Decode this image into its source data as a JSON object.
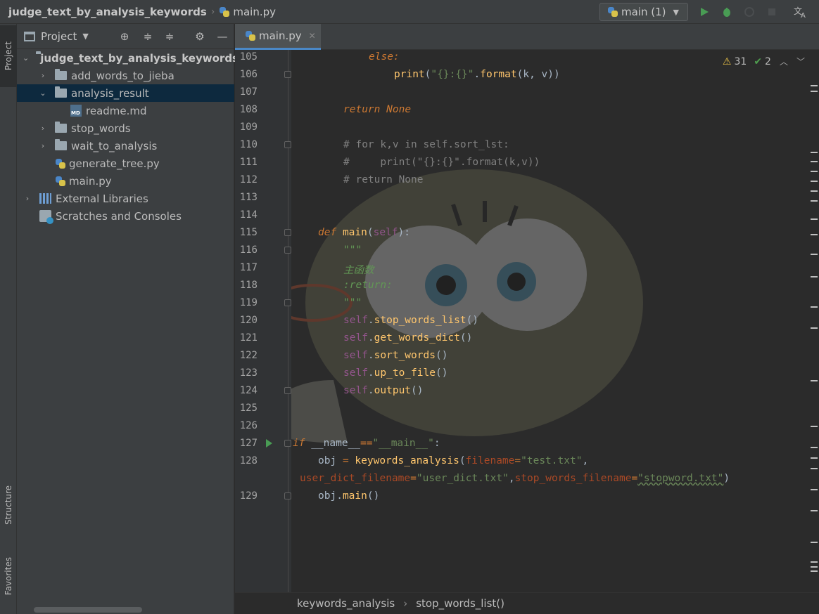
{
  "titlebar": {
    "project": "judge_text_by_analysis_keywords",
    "file": "main.py",
    "run_config": "main (1)"
  },
  "leftstrip": {
    "project_tab": "Project",
    "structure_tab": "Structure",
    "favorites_tab": "Favorites"
  },
  "project_panel": {
    "title": "Project",
    "tree": [
      {
        "label": "judge_text_by_analysis_keywords",
        "type": "folder",
        "expanded": true
      },
      {
        "label": "add_words_to_jieba",
        "type": "folder",
        "expanded": false
      },
      {
        "label": "analysis_result",
        "type": "folder",
        "expanded": true,
        "selected": true
      },
      {
        "label": "readme.md",
        "type": "md"
      },
      {
        "label": "stop_words",
        "type": "folder",
        "expanded": false
      },
      {
        "label": "wait_to_analysis",
        "type": "folder",
        "expanded": false
      },
      {
        "label": "generate_tree.py",
        "type": "py"
      },
      {
        "label": "main.py",
        "type": "py"
      },
      {
        "label": "External Libraries",
        "type": "lib",
        "expanded": false
      },
      {
        "label": "Scratches and Consoles",
        "type": "scratch"
      }
    ]
  },
  "editor": {
    "tab_label": "main.py",
    "inspections": {
      "warnings": "31",
      "weak_warnings": "2"
    },
    "line_numbers": [
      "105",
      "106",
      "107",
      "108",
      "109",
      "110",
      "111",
      "112",
      "113",
      "114",
      "115",
      "116",
      "117",
      "118",
      "119",
      "120",
      "121",
      "122",
      "123",
      "124",
      "125",
      "126",
      "127",
      "128",
      "",
      "129"
    ],
    "code": {
      "l105": "else:",
      "l106_print": "print",
      "l106_str": "\"{}:{}\"",
      "l106_format": "format",
      "l106_args": "(k, v))",
      "l108_return": "return",
      "l108_none": "None",
      "l110": "# for k,v in self.sort_lst:",
      "l111": "#     print(\"{}:{}\".format(k,v))",
      "l112": "# return None",
      "l115_def": "def",
      "l115_name": "main",
      "l115_self": "self",
      "l116": "\"\"\"",
      "l117": "主函数",
      "l118": ":return:",
      "l119": "\"\"\"",
      "l120": "stop_words_list",
      "l121": "get_words_dict",
      "l122": "sort_words",
      "l123": "up_to_file",
      "l124": "output",
      "self_kw": "self",
      "l127_if": "if",
      "l127_name": "__name__",
      "l127_eq": "==",
      "l127_main": "\"__main__\"",
      "l128_obj": "obj",
      "l128_cls": "keywords_analysis",
      "l128_p1": "filename",
      "l128_v1": "\"test.txt\"",
      "l128b_p2": "user_dict_filename",
      "l128b_v2": "\"user_dict.txt\"",
      "l128b_p3": "stop_words_filename",
      "l128b_v3": "\"stopword.txt\"",
      "l129_obj": "obj",
      "l129_main": "main"
    }
  },
  "statusbar": {
    "crumb1": "keywords_analysis",
    "crumb2": "stop_words_list()"
  }
}
